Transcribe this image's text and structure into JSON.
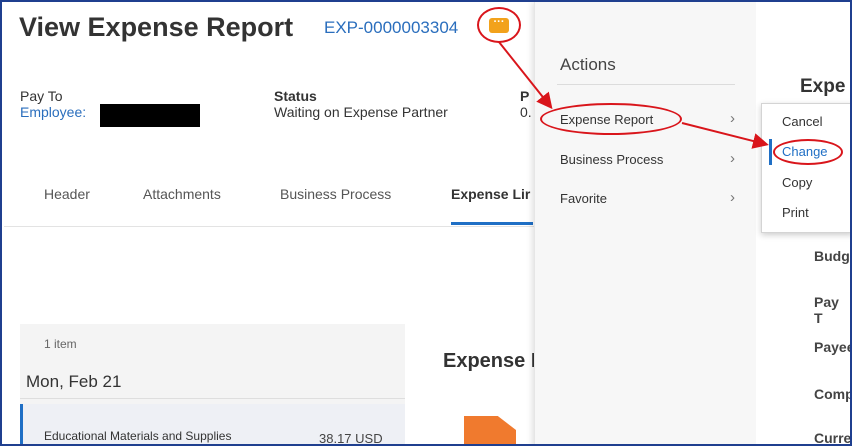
{
  "header": {
    "title": "View Expense Report",
    "report_id": "EXP-0000003304",
    "more_icon": "ellipsis-icon"
  },
  "fields": {
    "pay_to_label": "Pay To",
    "pay_to_value": "Employee:",
    "status_label": "Status",
    "status_value": "Waiting on Expense Partner",
    "cut_label": "P",
    "cut_value": "0."
  },
  "tabs": [
    {
      "label": "Header"
    },
    {
      "label": "Attachments"
    },
    {
      "label": "Business Process"
    },
    {
      "label": "Expense Lir",
      "active": true
    }
  ],
  "lines": {
    "count": "1 item",
    "date": "Mon, Feb 21",
    "items": [
      {
        "name": "Educational Materials and Supplies",
        "amount": "38.17 USD"
      }
    ],
    "detail_heading": "Expense I"
  },
  "actions_menu": {
    "title": "Actions",
    "items": [
      {
        "label": "Expense Report"
      },
      {
        "label": "Business Process"
      },
      {
        "label": "Favorite"
      }
    ]
  },
  "submenu": {
    "items": [
      {
        "label": "Cancel"
      },
      {
        "label": "Change"
      },
      {
        "label": "Copy"
      },
      {
        "label": "Print"
      }
    ]
  },
  "right_panel": {
    "heading": "Expe",
    "labels": [
      "Budg",
      "Pay T",
      "Payee",
      "Comp",
      "Curre"
    ]
  },
  "colors": {
    "accent": "#2a6ebd",
    "highlight": "#d9151b",
    "more_button": "#f2a21c",
    "document": "#f07a2e"
  }
}
